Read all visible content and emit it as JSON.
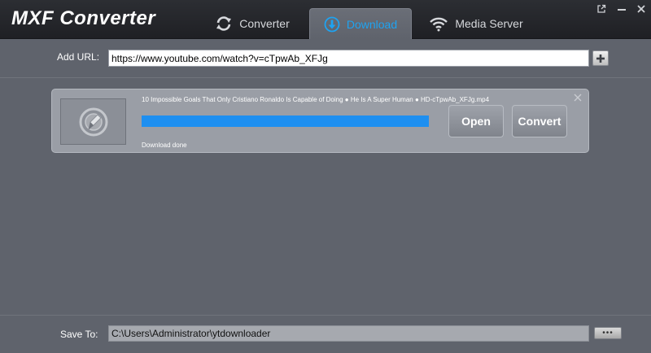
{
  "app": {
    "title": "MXF Converter"
  },
  "tabs": [
    {
      "label": "Converter",
      "icon": "refresh-icon",
      "active": false
    },
    {
      "label": "Download",
      "icon": "download-icon",
      "active": true
    },
    {
      "label": "Media Server",
      "icon": "wifi-icon",
      "active": false
    }
  ],
  "window_controls": [
    "popout-icon",
    "minimize-icon",
    "close-icon"
  ],
  "url_bar": {
    "label": "Add URL:",
    "value": "https://www.youtube.com/watch?v=cTpwAb_XFJg",
    "add_icon": "plus-icon"
  },
  "download_item": {
    "file_name": "10 Impossible Goals That Only Cristiano Ronaldo Is Capable of Doing ● He Is A Super Human ● HD-cTpwAb_XFJg.mp4",
    "progress": 1.0,
    "status": "Download done",
    "open_label": "Open",
    "convert_label": "Convert",
    "thumbnail_icon": "edit-video-icon"
  },
  "save_to": {
    "label": "Save To:",
    "value": "C:\\Users\\Administrator\\ytdownloader",
    "browse_label": "•••"
  },
  "colors": {
    "accent": "#1ea3f1",
    "progress": "#1e8ff0",
    "background": "#5f636c",
    "titlebar": "#25272b"
  }
}
